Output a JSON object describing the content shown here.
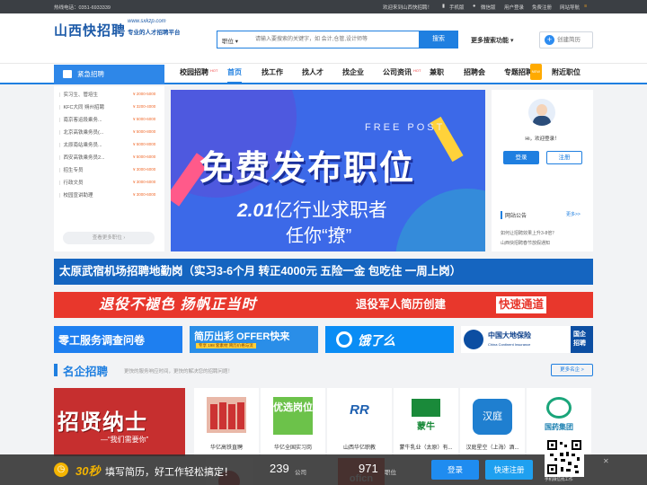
{
  "topbar": {
    "hotline": "热线电话：0351-6933339",
    "links": [
      "欢迎来到山西快招聘！",
      "手机版",
      "微信版",
      "用户登录",
      "免费注册",
      "网站导航"
    ]
  },
  "header": {
    "logo_text": "山西快招聘",
    "logo_url": "www.sxkzp.com",
    "slogan": "专业的人才招聘平台",
    "search_type": "职位",
    "search_placeholder": "请输入要搜索的关键字，如 会计,仓管,设计师等",
    "search_button": "搜索",
    "more_search": "更多搜索功能",
    "create_resume": "创建简历"
  },
  "nav": {
    "category_title": "紧急招聘",
    "items": [
      "校园招聘",
      "首页",
      "找工作",
      "找人才",
      "找企业",
      "公司资讯",
      "兼职",
      "招聘会",
      "专题招聘",
      "附近职位"
    ],
    "hot_label": "HOT",
    "new_label": "NEW"
  },
  "jobs": [
    {
      "title": "实习生、管培生",
      "salary": "¥ 2000-5000"
    },
    {
      "title": "KFC大同 朔州招聘",
      "salary": "¥ 3200-4000"
    },
    {
      "title": "南京客运段乘务...",
      "salary": "¥ 5000-6000"
    },
    {
      "title": "北京高铁乘务员(...",
      "salary": "¥ 5000-8000"
    },
    {
      "title": "太原南站乘务员...",
      "salary": "¥ 5000-8000"
    },
    {
      "title": "西安高铁乘务员2...",
      "salary": "¥ 5000-6000"
    },
    {
      "title": "招生专员",
      "salary": "¥ 3000-6000"
    },
    {
      "title": "行政文员",
      "salary": "¥ 3000-6000"
    },
    {
      "title": "校园宣讲助理",
      "salary": "¥ 3000-6000"
    }
  ],
  "more_jobs": "查看更多职位",
  "banner": {
    "en": "FREE  POST",
    "headline": "免费发布职位",
    "num": "2.01",
    "line1": "亿行业求职者",
    "line2": "任你“撩”"
  },
  "right": {
    "greeting": "Hi，欢迎登录！",
    "login": "登录",
    "register": "注册",
    "notice_title": "网站公告",
    "notice_more": "更多>>",
    "notices": [
      "如何让招聘效果上升3-8倍？",
      "山西快招聘春节放假通知"
    ]
  },
  "strip1": "太原武宿机场招聘地勤岗（实习3-6个月 转正4000元 五险一金 包吃住 一周上岗）",
  "strip2": {
    "slogan": "退役不褪色 扬帆正当时",
    "text": "退役军人简历创建",
    "highlight": "快速通道"
  },
  "ads": [
    {
      "title": "零工服务调查问卷"
    },
    {
      "title": "简历出彩 OFFER快来",
      "sub": "专享 198 套素材 简历价格与流"
    },
    {
      "title": "饿了么"
    },
    {
      "title": "中国大地保险",
      "sub": "China Continent Insurance",
      "tag": "国企招聘"
    }
  ],
  "famous": {
    "title": "名企招聘",
    "subtitle": "更快的服务响应时间，更快的解决您的招聘问题！",
    "more": "更多名企 >"
  },
  "poster": {
    "big": "招贤纳士",
    "sub": "—“我们需要你”"
  },
  "companies": [
    {
      "name": "华亿高铁直聘"
    },
    {
      "name": "华亿全国实习岗",
      "logo_text": "优选岗位"
    },
    {
      "name": "山西华亿职教"
    },
    {
      "name": "蒙牛乳业（太原）有...",
      "logo_text": "蒙牛"
    },
    {
      "name": "汉庭星空（上海）酒...",
      "logo_text": "汉庭"
    },
    {
      "name": "国药集团",
      "logo_text": "国药集团"
    }
  ],
  "bottom": {
    "sec": "30秒",
    "text": "填写简历，好工作轻松搞定！",
    "companies": "239",
    "companies_label": "公司",
    "jobs": "971",
    "jobs_label": "职位",
    "login": "登录",
    "register": "快速注册",
    "qr_caption": "手机微信找工作"
  },
  "colors": {
    "brand": "#1f7fe0",
    "accent": "#f06a2c",
    "red": "#e8372c"
  }
}
